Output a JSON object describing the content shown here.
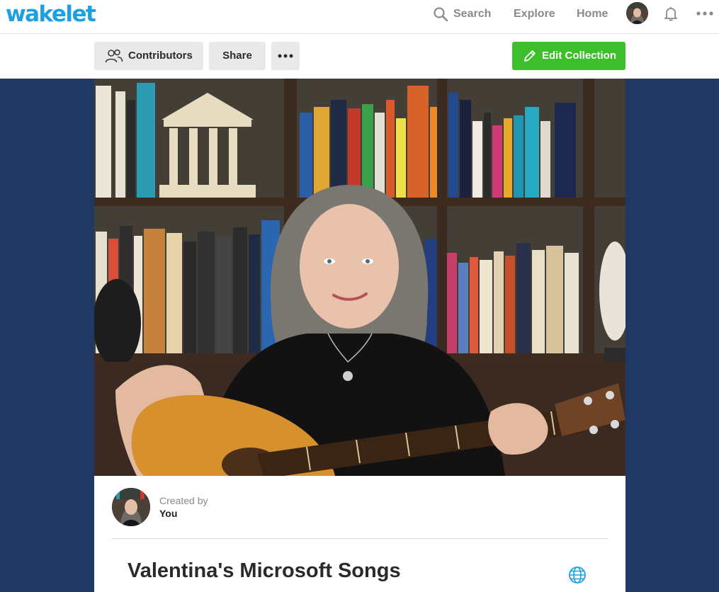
{
  "brand": {
    "logo_text": "wakelet",
    "color": "#1ba0e2"
  },
  "topnav": {
    "search_label": "Search",
    "explore_label": "Explore",
    "home_label": "Home"
  },
  "toolbar": {
    "contributors_label": "Contributors",
    "share_label": "Share",
    "edit_label": "Edit Collection",
    "edit_color": "#3cbf2a"
  },
  "collection": {
    "created_by_label": "Created by",
    "creator_name": "You",
    "title": "Valentina's Microsoft Songs"
  },
  "colors": {
    "page_background": "#1f3864"
  }
}
